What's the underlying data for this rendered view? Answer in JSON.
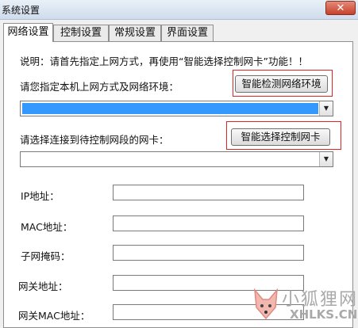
{
  "window": {
    "title": "系统设置",
    "close_symbol": "✕"
  },
  "tabs": [
    {
      "label": "网络设置",
      "active": true
    },
    {
      "label": "控制设置",
      "active": false
    },
    {
      "label": "常规设置",
      "active": false
    },
    {
      "label": "界面设置",
      "active": false
    }
  ],
  "network": {
    "note": "说明：请首先指定上网方式，再使用“智能选择控制网卡”功能！！",
    "env_label": "请您指定本机上网方式及网络环境：",
    "detect_button": "智能检测网络环境",
    "env_select_value": "",
    "nic_label": "请选择连接到待控制网段的网卡：",
    "select_nic_button": "智能选择控制网卡",
    "nic_select_value": "",
    "fields": {
      "ip_label": "IP地址：",
      "ip_value": "",
      "mac_label": "MAC地址：",
      "mac_value": "",
      "subnet_label": "子网掩码：",
      "subnet_value": "",
      "gateway_label": "网关地址：",
      "gateway_value": "",
      "gateway_mac_label": "网关MAC地址：",
      "gateway_mac_value": ""
    }
  },
  "watermark": {
    "cn": "小狐狸网",
    "en": "XHLKS.CN"
  },
  "colors": {
    "highlight_border": "#e02424",
    "selection": "#3399ff",
    "close_button": "#c6412b"
  }
}
